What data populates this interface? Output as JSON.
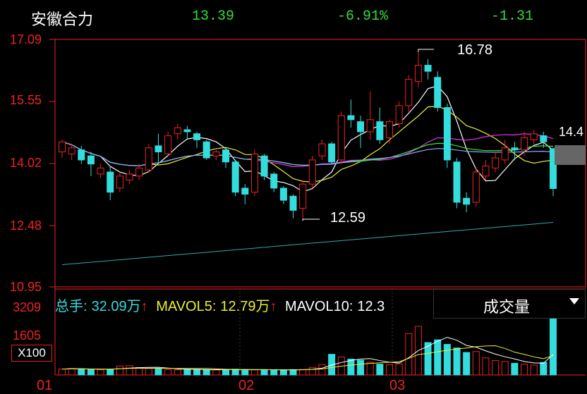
{
  "header": {
    "stock_name": "安徽合力",
    "price": "13.39",
    "change_pct": "-6.91%",
    "change": "-1.31"
  },
  "price_axis": {
    "labels": [
      "17.09",
      "15.55",
      "14.02",
      "12.48",
      "10.95"
    ]
  },
  "volume_axis": {
    "top": "3209",
    "mid": "1605",
    "unit": "X100"
  },
  "date_axis": {
    "labels": [
      "01",
      "02",
      "03"
    ]
  },
  "annotations": {
    "max": "16.78",
    "min": "12.59",
    "current": "14.4"
  },
  "volume_info": {
    "total_label": "总手:",
    "total_value": "32.09万",
    "mavol5_label": "MAVOL5:",
    "mavol5_value": "12.79万",
    "mavol10_label": "MAVOL10:",
    "mavol10_value": "12.3",
    "arrow": "↑"
  },
  "indicator_select": {
    "value": "成交量",
    "icon": "chevron-down-icon"
  },
  "colors": {
    "up": "#ee2222",
    "down": "#33dddd",
    "axis": "#ee2222",
    "header_down": "#33dd33"
  },
  "chart_data": {
    "type": "candlestick",
    "ylim": [
      10.95,
      17.09
    ],
    "volume_ylim": [
      0,
      3209
    ],
    "max_price": 16.78,
    "min_price": 12.59,
    "candles": [
      [
        14.3,
        14.55,
        14.15,
        14.6
      ],
      [
        14.25,
        14.4,
        14.1,
        14.5
      ],
      [
        14.35,
        14.1,
        14.0,
        14.45
      ],
      [
        14.2,
        14.0,
        13.7,
        14.3
      ],
      [
        13.75,
        13.9,
        13.65,
        14.0
      ],
      [
        13.8,
        13.3,
        13.1,
        13.95
      ],
      [
        13.4,
        13.7,
        13.3,
        13.8
      ],
      [
        13.6,
        13.75,
        13.5,
        13.85
      ],
      [
        13.7,
        13.9,
        13.6,
        14.0
      ],
      [
        13.85,
        14.4,
        13.8,
        14.5
      ],
      [
        14.45,
        14.3,
        14.0,
        14.75
      ],
      [
        14.25,
        14.7,
        14.2,
        14.8
      ],
      [
        14.75,
        14.9,
        14.6,
        15.0
      ],
      [
        14.85,
        14.8,
        14.6,
        14.95
      ],
      [
        14.75,
        14.6,
        14.4,
        14.8
      ],
      [
        14.55,
        14.15,
        14.1,
        14.6
      ],
      [
        14.2,
        14.3,
        14.1,
        14.35
      ],
      [
        14.35,
        14.05,
        13.9,
        14.4
      ],
      [
        14.05,
        13.3,
        13.2,
        14.1
      ],
      [
        13.4,
        13.25,
        13.0,
        13.5
      ],
      [
        13.3,
        14.25,
        13.2,
        14.35
      ],
      [
        14.2,
        13.7,
        13.6,
        14.25
      ],
      [
        13.75,
        13.4,
        13.3,
        13.8
      ],
      [
        13.4,
        13.1,
        13.0,
        13.45
      ],
      [
        13.2,
        12.85,
        12.65,
        13.25
      ],
      [
        12.9,
        13.5,
        12.59,
        13.6
      ],
      [
        13.5,
        14.1,
        13.4,
        14.2
      ],
      [
        14.2,
        14.5,
        14.1,
        14.6
      ],
      [
        14.5,
        14.05,
        14.0,
        14.55
      ],
      [
        14.1,
        15.2,
        14.0,
        15.3
      ],
      [
        15.2,
        15.1,
        14.9,
        15.6
      ],
      [
        15.05,
        14.8,
        14.4,
        15.2
      ],
      [
        14.8,
        15.1,
        14.6,
        15.8
      ],
      [
        15.05,
        14.6,
        14.5,
        15.4
      ],
      [
        14.65,
        15.05,
        14.5,
        15.1
      ],
      [
        15.0,
        15.45,
        14.9,
        15.55
      ],
      [
        15.45,
        16.1,
        15.3,
        16.2
      ],
      [
        16.05,
        16.45,
        15.9,
        16.78
      ],
      [
        16.45,
        16.3,
        16.1,
        16.6
      ],
      [
        16.15,
        15.4,
        15.3,
        16.3
      ],
      [
        15.4,
        14.1,
        13.9,
        15.5
      ],
      [
        14.05,
        13.05,
        12.9,
        14.15
      ],
      [
        13.15,
        13.0,
        12.8,
        13.3
      ],
      [
        13.05,
        13.8,
        12.95,
        13.9
      ],
      [
        13.7,
        13.95,
        13.6,
        14.1
      ],
      [
        13.9,
        14.15,
        13.8,
        14.3
      ],
      [
        14.1,
        14.4,
        14.0,
        14.6
      ],
      [
        14.4,
        14.35,
        14.1,
        14.55
      ],
      [
        14.35,
        14.65,
        14.2,
        14.8
      ],
      [
        14.6,
        14.75,
        14.5,
        14.85
      ],
      [
        14.7,
        14.55,
        14.4,
        14.8
      ],
      [
        14.38,
        13.39,
        13.2,
        14.4
      ]
    ],
    "volumes": [
      330,
      360,
      340,
      300,
      290,
      310,
      500,
      520,
      410,
      360,
      330,
      300,
      290,
      310,
      300,
      290,
      280,
      300,
      320,
      300,
      280,
      290,
      280,
      270,
      300,
      310,
      420,
      580,
      1150,
      1000,
      880,
      820,
      700,
      600,
      560,
      620,
      2300,
      2700,
      1800,
      1950,
      1700,
      1500,
      1250,
      1300,
      950,
      800,
      750,
      650,
      600,
      550,
      700,
      3209
    ]
  }
}
